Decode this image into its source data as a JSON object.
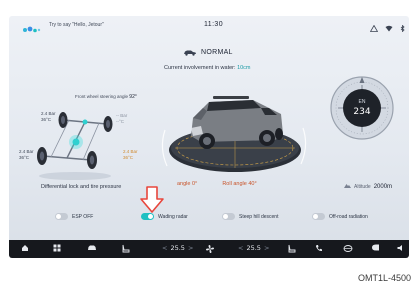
{
  "status_bar": {
    "voice_hint": "Try to say \"Hello, Jetour\"",
    "time": "11:30"
  },
  "mode": {
    "name": "NORMAL"
  },
  "water": {
    "label": "Current involvement in water:",
    "value": "10cm"
  },
  "steering": {
    "label": "Front wheel steering angle",
    "value": "92°"
  },
  "tires": {
    "front_left_pressure": "2.4 Bar",
    "front_left_temp": "36°C",
    "front_right_pressure": "-- Bar",
    "front_right_temp": "--°C",
    "rear_left_pressure": "2.4 Bar",
    "rear_left_temp": "36°C",
    "rear_right_pressure": "2.4 Bar",
    "rear_right_temp": "36°C"
  },
  "compass": {
    "direction": "EN",
    "heading": "234"
  },
  "attitude": {
    "pitch_label": "angle",
    "pitch_value": "0°",
    "roll_label": "Roll angle",
    "roll_value": "40°"
  },
  "differential": {
    "label": "Differential lock and tire pressure"
  },
  "altitude": {
    "label": "Altitude",
    "value": "2000m"
  },
  "toggles": [
    {
      "label": "ESP OFF",
      "on": false
    },
    {
      "label": "Wading radar",
      "on": true
    },
    {
      "label": "Steep hill descent",
      "on": false
    },
    {
      "label": "Off-road radiation",
      "on": false
    }
  ],
  "dock": {
    "temp_left": "25.5",
    "temp_right": "25.5"
  },
  "figure_code": "OMT1L-4500",
  "colors": {
    "accent": "#1ec0c2",
    "callout": "#e8463c",
    "dock_bg": "#16181d",
    "angle_text": "#c8542a"
  }
}
